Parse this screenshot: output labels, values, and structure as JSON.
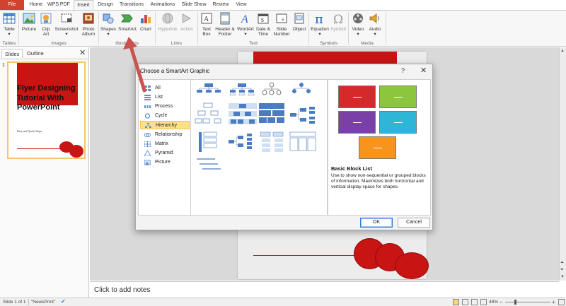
{
  "tabs": [
    "File",
    "Home",
    "WPS PDF",
    "Insert",
    "Design",
    "Transitions",
    "Animations",
    "Slide Show",
    "Review",
    "View"
  ],
  "active_tab": "Insert",
  "ribbon": {
    "table": "Table",
    "picture": "Picture",
    "clip_art": "Clip Art",
    "screenshot": "Screenshot",
    "photo_album": "Photo Album",
    "shapes": "Shapes",
    "smartart": "SmartArt",
    "chart": "Chart",
    "hyperlink": "Hyperlink",
    "action": "Action",
    "text_box": "Text Box",
    "header_footer": "Header & Footer",
    "wordart": "WordArt",
    "date_time": "Date & Time",
    "slide_number": "Slide Number",
    "object": "Object",
    "equation": "Equation",
    "symbol": "Symbol",
    "video": "Video",
    "audio": "Audio",
    "groups": {
      "tables": "Tables",
      "images": "Images",
      "illustrations": "Illustrations",
      "links": "Links",
      "text": "Text",
      "symbols": "Symbols",
      "media": "Media"
    }
  },
  "left_pane": {
    "tab_slides": "Slides",
    "tab_outline": "Outline",
    "slide_number": "1",
    "thumb_title": "Flyer Designing Tutorial With PowerPoint",
    "thumb_subtitle": "Easy and Quick Steps"
  },
  "dialog": {
    "title": "Choose a SmartArt Graphic",
    "help": "?",
    "categories": [
      "All",
      "List",
      "Process",
      "Cycle",
      "Hierarchy",
      "Relationship",
      "Matrix",
      "Pyramid",
      "Picture"
    ],
    "selected_category": "Hierarchy",
    "preview_name": "Basic Block List",
    "preview_desc": "Use to show non-sequential or grouped blocks of information. Maximizes both horizontal and vertical display space for shapes.",
    "ok": "OK",
    "cancel": "Cancel",
    "preview_colors": [
      "#d42a2a",
      "#8cc63f",
      "#7b3fa8",
      "#2fb6d6",
      "#f7941d"
    ]
  },
  "notes": {
    "placeholder": "Click to add notes"
  },
  "status": {
    "slide": "Slide 1 of 1",
    "theme": "\"NewsPrint\"",
    "zoom": "48%"
  },
  "colors": {
    "file_tab": "#d2432f",
    "accent_red": "#c91414",
    "arrow": "#c9524e",
    "selection": "#fde08c"
  }
}
